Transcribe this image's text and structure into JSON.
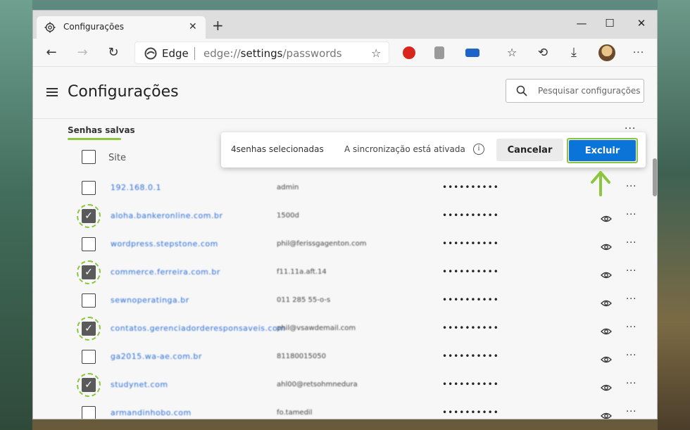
{
  "browser": {
    "tab_title": "Configurações",
    "address_brand": "Edge",
    "url_prefix": "edge://",
    "url_path": "settings",
    "url_suffix": "/passwords"
  },
  "settings": {
    "page_title": "Configurações",
    "search_placeholder": "Pesquisar configurações",
    "section_title": "Senhas salvas",
    "column_site": "Site"
  },
  "action_bar": {
    "selected_count": "4senhas selecionadas",
    "sync_status": "A sincronização está ativada",
    "cancel_label": "Cancelar",
    "delete_label": "Excluir"
  },
  "passwords": [
    {
      "site": "192.168.0.1",
      "user": "admin",
      "password": "••••••••••",
      "checked": false,
      "eye": false
    },
    {
      "site": "aloha.bankeronline.com.br",
      "user": "1500d",
      "password": "••••••••••",
      "checked": true,
      "eye": true
    },
    {
      "site": "wordpress.stepstone.com",
      "user": "phil@ferissgagenton.com",
      "password": "••••••••••",
      "checked": false,
      "eye": true
    },
    {
      "site": "commerce.ferreira.com.br",
      "user": "f11.11a.aft.14",
      "password": "••••••••••",
      "checked": true,
      "eye": true
    },
    {
      "site": "sewnoperatinga.br",
      "user": "011 285 55-o-s",
      "password": "••••••••••",
      "checked": false,
      "eye": true
    },
    {
      "site": "contatos.gerenciadorderesponsaveis.com",
      "user": "phil@vsawdemail.com",
      "password": "••••••••••",
      "checked": true,
      "eye": true
    },
    {
      "site": "ga2015.wa-ae.com.br",
      "user": "81180015050",
      "password": "••••••••••",
      "checked": false,
      "eye": true
    },
    {
      "site": "studynet.com",
      "user": "ahl00@retsohmnedura",
      "password": "••••••••••",
      "checked": true,
      "eye": true
    },
    {
      "site": "armandinhobo.com",
      "user": "fo.tamedil",
      "password": "••••••••••",
      "checked": false,
      "eye": true
    }
  ]
}
